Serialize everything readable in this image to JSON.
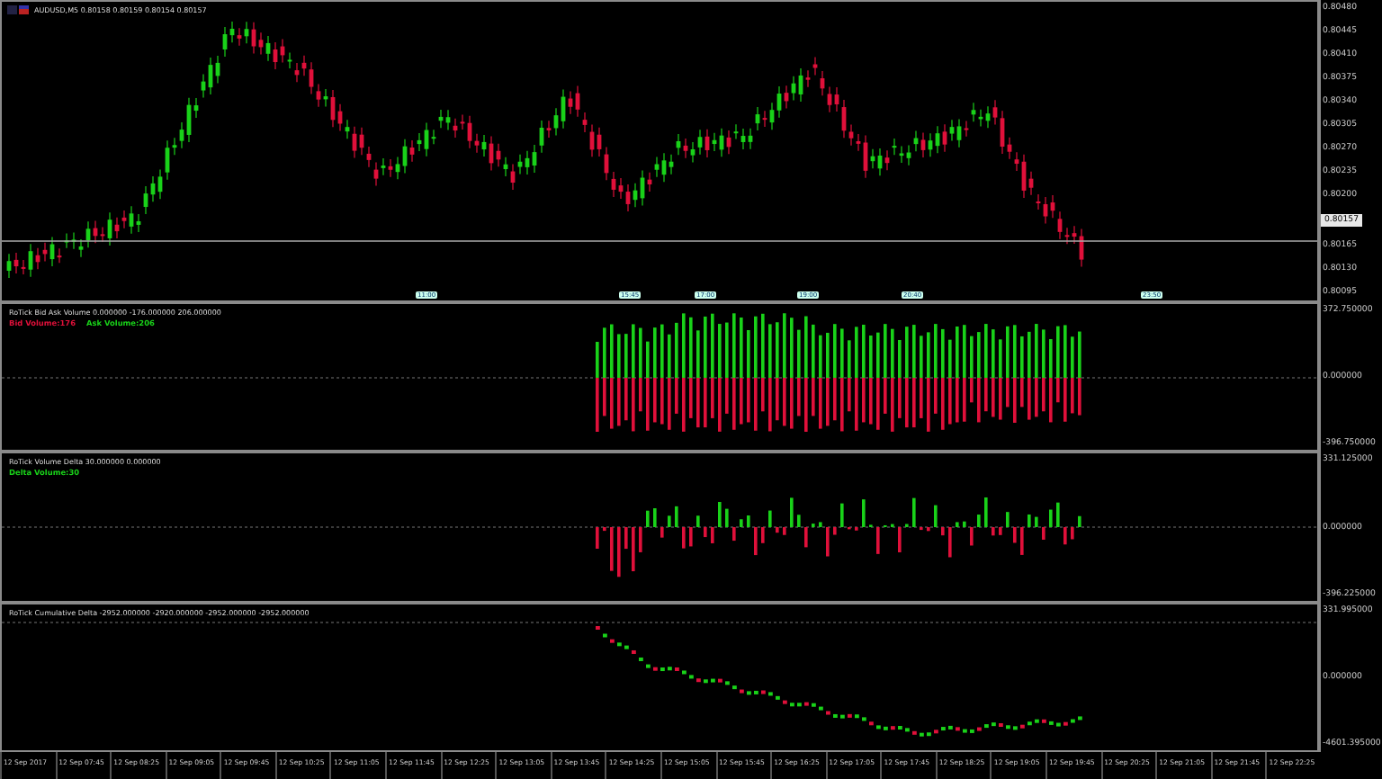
{
  "symbol": {
    "title": "AUDUSD,M5  0.80158 0.80159 0.80154 0.80157"
  },
  "price_axis": [
    "0.80480",
    "0.80445",
    "0.80410",
    "0.80375",
    "0.80340",
    "0.80305",
    "0.80270",
    "0.80235",
    "0.80200",
    "0.80165",
    "0.80130",
    "0.80095"
  ],
  "current_price": "0.80157",
  "time_markers": [
    "11:00",
    "15:45",
    "17:00",
    "19:00",
    "20:40",
    "23:50"
  ],
  "indicators": [
    {
      "kind": "bidask",
      "title": "RoTick Bid Ask Volume 0.000000 -176.000000 206.000000",
      "legend": [
        {
          "text": "Bid Volume:176",
          "color": "#e0103a"
        },
        {
          "text": "Ask Volume:206",
          "color": "#19d219"
        }
      ],
      "axis": [
        "372.750000",
        "0.000000",
        "-396.750000"
      ]
    },
    {
      "kind": "delta",
      "title": "RoTick Volume Delta 30.000000 0.000000",
      "legend": [
        {
          "text": "Delta Volume:30",
          "color": "#19d219"
        }
      ],
      "axis": [
        "331.125000",
        "0.000000",
        "-396.225000"
      ]
    },
    {
      "kind": "cumulative",
      "title": "RoTick Cumulative Delta -2952.000000 -2920.000000 -2952.000000 -2952.000000",
      "axis": [
        "331.995000",
        "0.000000",
        "-4601.395000"
      ]
    }
  ],
  "time_axis": [
    "12 Sep 2017",
    "12 Sep 07:45",
    "12 Sep 08:25",
    "12 Sep 09:05",
    "12 Sep 09:45",
    "12 Sep 10:25",
    "12 Sep 11:05",
    "12 Sep 11:45",
    "12 Sep 12:25",
    "12 Sep 13:05",
    "12 Sep 13:45",
    "12 Sep 14:25",
    "12 Sep 15:05",
    "12 Sep 15:45",
    "12 Sep 16:25",
    "12 Sep 17:05",
    "12 Sep 17:45",
    "12 Sep 18:25",
    "12 Sep 19:05",
    "12 Sep 19:45",
    "12 Sep 20:25",
    "12 Sep 21:05",
    "12 Sep 21:45",
    "12 Sep 22:25"
  ]
}
